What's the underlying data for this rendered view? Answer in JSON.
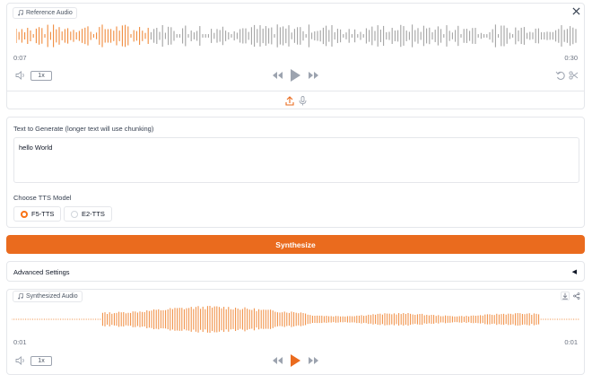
{
  "reference_audio": {
    "label": "Reference Audio",
    "time_current": "0:07",
    "time_total": "0:30",
    "speed": "1x",
    "progress": 0.24
  },
  "text_input": {
    "label": "Text to Generate (longer text will use chunking)",
    "value": "hello World"
  },
  "model": {
    "label": "Choose TTS Model",
    "options": [
      "F5-TTS",
      "E2-TTS"
    ],
    "selected": "F5-TTS"
  },
  "synthesize_label": "Synthesize",
  "advanced_settings": {
    "label": "Advanced Settings",
    "arrow": "◀"
  },
  "synthesized_audio": {
    "label": "Synthesized Audio",
    "time_current": "0:01",
    "time_total": "0:01",
    "speed": "1x",
    "progress": 1.0
  },
  "colors": {
    "accent": "#ea6b1e",
    "waveform_played": "#f08a3c",
    "waveform_unplayed": "#a3a3a3"
  },
  "icons": [
    "music-note-icon",
    "close-icon",
    "volume-icon",
    "rewind-icon",
    "play-icon",
    "fast-forward-icon",
    "undo-icon",
    "scissors-icon",
    "upload-icon",
    "microphone-icon",
    "download-icon",
    "share-icon"
  ]
}
